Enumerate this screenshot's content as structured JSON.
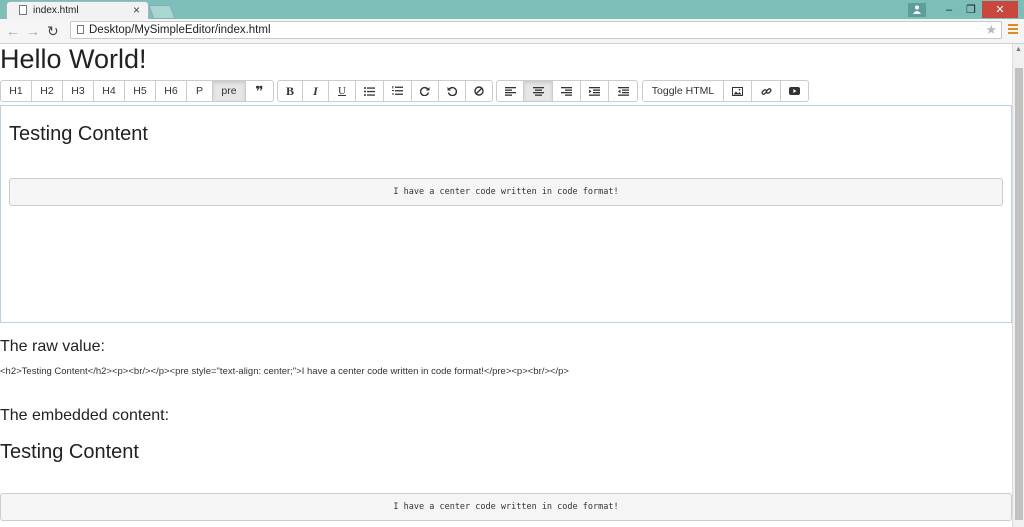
{
  "browser": {
    "tab_title": "index.html",
    "tab_close": "×",
    "url": "Desktop/MySimpleEditor/index.html",
    "window_controls": {
      "minimize": "–",
      "maximize": "❐",
      "close": "✕"
    },
    "nav": {
      "back": "←",
      "forward": "→",
      "reload": "↻"
    },
    "bookmark_star": "★"
  },
  "page": {
    "heading": "Hello World!",
    "toolbar": {
      "headings": [
        "H1",
        "H2",
        "H3",
        "H4",
        "H5",
        "H6",
        "P",
        "pre"
      ],
      "quote": "❞",
      "bold": "B",
      "italic": "I",
      "underline": "U",
      "toggle_html": "Toggle HTML",
      "active_items": [
        "pre",
        "align-center"
      ]
    },
    "editor": {
      "heading": "Testing Content",
      "code": "I have a center code written in code format!"
    },
    "raw_section": {
      "title": "The raw value:",
      "value": "<h2>Testing Content</h2><p><br/></p><pre style=\"text-align: center;\">I have a center code written in code format!</pre><p><br/></p>"
    },
    "embedded_section": {
      "title": "The embedded content:",
      "heading": "Testing Content",
      "code": "I have a center code written in code format!"
    }
  },
  "colors": {
    "titlebar": "#7bbfb8",
    "close_button": "#c9473c",
    "menu_icon": "#e08a1e",
    "editor_border": "#b9d0e6"
  }
}
